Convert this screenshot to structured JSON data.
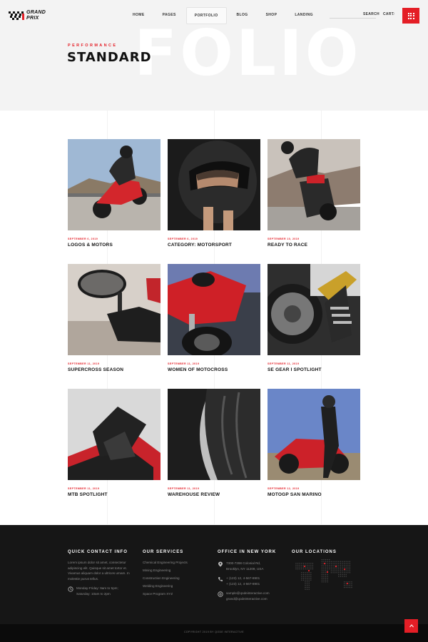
{
  "brand": {
    "line1": "GRAND",
    "line2": "PRIX"
  },
  "nav": [
    {
      "label": "HOME",
      "active": false
    },
    {
      "label": "PAGES",
      "active": false
    },
    {
      "label": "PORTFOLIO",
      "active": true
    },
    {
      "label": "BLOG",
      "active": false
    },
    {
      "label": "SHOP",
      "active": false
    },
    {
      "label": "LANDING",
      "active": false
    }
  ],
  "header": {
    "search_label": "SEARCH",
    "cart_label": "CART",
    "cart_count": "0",
    "menu_icon": "grid-dots-icon"
  },
  "hero": {
    "subtitle": "PERFORMANCE",
    "title": "STANDARD",
    "watermark": "FOLIO"
  },
  "portfolio": [
    {
      "date": "SEPTEMBER 6, 2019",
      "title": "LOGOS & MOTORS"
    },
    {
      "date": "SEPTEMBER 6, 2019",
      "title": "CATEGORY: MOTORSPORT"
    },
    {
      "date": "SEPTEMBER 10, 2019",
      "title": "READY TO RACE"
    },
    {
      "date": "SEPTEMBER 11, 2019",
      "title": "SUPERCROSS SEASON"
    },
    {
      "date": "SEPTEMBER 11, 2019",
      "title": "WOMEN OF MOTOCROSS"
    },
    {
      "date": "SEPTEMBER 11, 2019",
      "title": "SE GEAR I SPOTLIGHT"
    },
    {
      "date": "SEPTEMBER 11, 2019",
      "title": "MTB SPOTLIGHT"
    },
    {
      "date": "SEPTEMBER 11, 2019",
      "title": "WAREHOUSE REVIEW"
    },
    {
      "date": "SEPTEMBER 12, 2019",
      "title": "MOTOGP SAN MARINO"
    }
  ],
  "footer": {
    "contact": {
      "title": "QUICK CONTACT INFO",
      "text": "Lorem ipsum dolor sit amet, consectetur adipiscing elit. Quisque sit amet tortor et. Vivamus aliquam dolor a ultrices urnam. In molestie purus tellus.",
      "hours_line1": "Monday-Friday: 9am to 5pm;",
      "hours_line2": "Saturday: 10am to 2pm"
    },
    "services": {
      "title": "OUR SERVICES",
      "items": [
        "Chemical Engineering Projects",
        "Mining Engineering",
        "Construction Engineering",
        "Welding Engineering",
        "Space Program XYZ"
      ]
    },
    "office": {
      "title": "OFFICE IN NEW YORK",
      "address1": "7300-7398 Colonial Rd,",
      "address2": "Brooklyn, NY 11209, USA",
      "phone1": "+ (123) 12, 4-567-8901",
      "phone2": "+ (123) 12, 4-567-8901",
      "email1": "sample@qodeinteractive.com",
      "email2": "grand@qodeinteractive.com"
    },
    "locations": {
      "title": "OUR LOCATIONS"
    },
    "copyright": "COPYRIGHT 2019 BY QODE INTERACTIVE"
  },
  "colors": {
    "accent": "#e41e26",
    "footer_bg": "#161616",
    "hero_bg": "#f3f3f3"
  }
}
